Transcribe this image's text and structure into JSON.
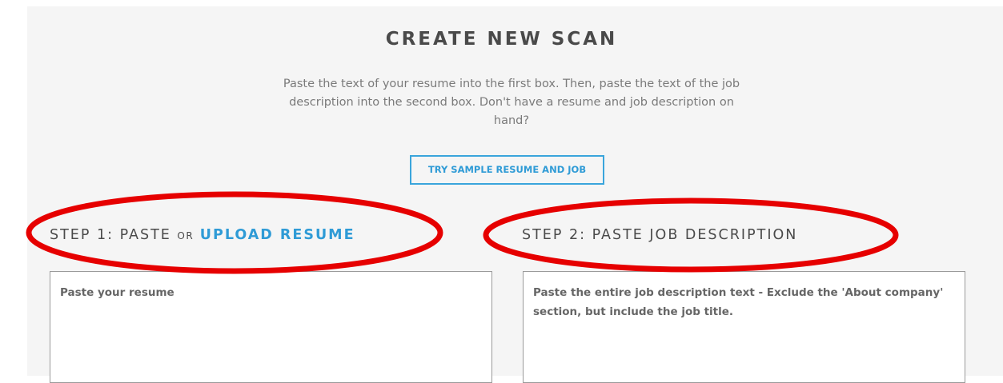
{
  "header": {
    "title": "CREATE NEW SCAN",
    "intro": "Paste the text of your resume into the first box. Then, paste the text of the job description into the second box. Don't have a resume and job description on hand?"
  },
  "sample_button": {
    "label": "TRY SAMPLE RESUME AND JOB"
  },
  "step1": {
    "prefix": "STEP 1: PASTE",
    "or": "OR",
    "link": "UPLOAD RESUME",
    "placeholder": "Paste your resume"
  },
  "step2": {
    "heading": "STEP 2: PASTE JOB DESCRIPTION",
    "placeholder": "Paste the entire job description text - Exclude the 'About company' section, but include the job title."
  },
  "colors": {
    "accent": "#2f9bd6",
    "panel_bg": "#f5f5f5",
    "heading_text": "#4a4a4a",
    "annotation": "#e60000"
  }
}
